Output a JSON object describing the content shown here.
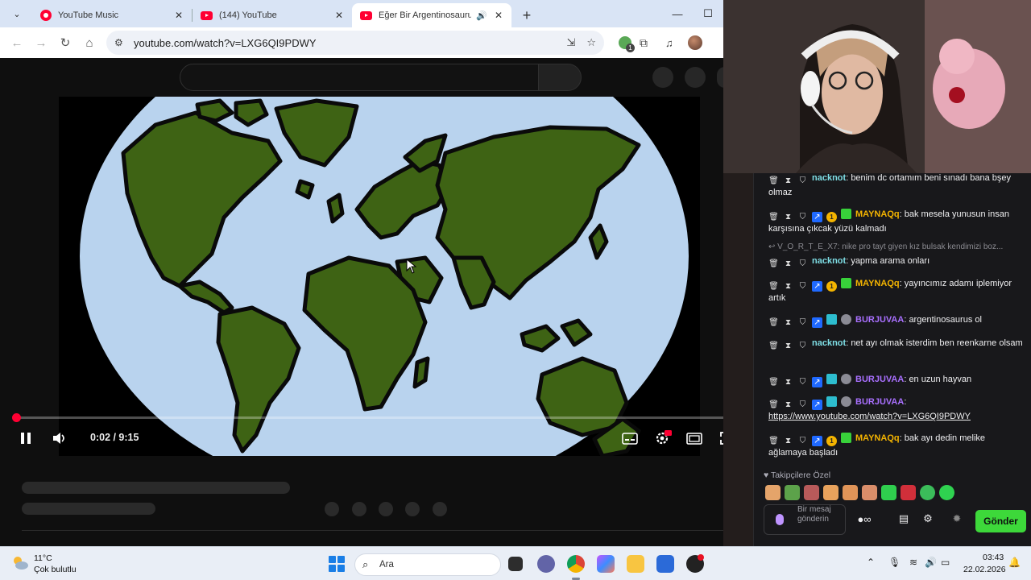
{
  "browser": {
    "tabs": [
      {
        "title": "YouTube Music",
        "icon": "youtube-music-icon"
      },
      {
        "title": "(144) YouTube",
        "icon": "youtube-icon"
      },
      {
        "title": "Eğer Bir Argentinosaurus Ol",
        "icon": "youtube-icon",
        "active": true
      }
    ],
    "url": "youtube.com/watch?v=LXG6QI9PDWY"
  },
  "player": {
    "current_time": "0:02",
    "duration": "9:15",
    "time_display": "0:02 / 9:15",
    "progress_fraction": 0.004,
    "hd_badge": "HD"
  },
  "chat": {
    "messages": [
      {
        "user": "nacknot",
        "color": "#7fdfe6",
        "text": "benim dc ortamım beni sınadı bana bşey olmaz"
      },
      {
        "user": "MAYNAQq",
        "color": "#f4b400",
        "text": "bak mesela yunusun insan karşısına çıkcak yüzü kalmadı"
      },
      {
        "reply_to": "V_O_R_T_E_X7: nike pro tayt giyen kız bulsak kendimizi boz..."
      },
      {
        "user": "nacknot",
        "color": "#7fdfe6",
        "text": "yapma arama onları"
      },
      {
        "user": "MAYNAQq",
        "color": "#f4b400",
        "text": "yayıncımız adamı iplemiyor artık"
      },
      {
        "user": "BURJUVAA",
        "color": "#a970ff",
        "text": "argentinosaurus ol"
      },
      {
        "user": "nacknot",
        "color": "#7fdfe6",
        "text": "net ayı olmak isterdim ben reenkarne olsam"
      },
      {
        "user": "BURJUVAA",
        "color": "#a970ff",
        "text": "en uzun hayvan"
      },
      {
        "user": "BURJUVAA",
        "color": "#a970ff",
        "text": "https://www.youtube.com/watch?v=LXG6QI9PDWY"
      },
      {
        "user": "MAYNAQq",
        "color": "#f4b400",
        "text": "bak ayı dedin melike ağlamaya başladı"
      }
    ],
    "coin_badge": "1",
    "followers_only": "Takipçilere Özel",
    "input_placeholder": "Bir mesaj gönderin",
    "send_label": "Gönder"
  },
  "taskbar": {
    "temperature": "11°C",
    "weather": "Çok bulutlu",
    "search_placeholder": "Ara",
    "time": "03:43",
    "date": "22.02.2026"
  },
  "colors": {
    "youtube_red": "#ff0033",
    "twitch_purple": "#a970ff",
    "send_green": "#3dd83a",
    "ocean": "#b9d3ee",
    "land": "#3e6314"
  }
}
